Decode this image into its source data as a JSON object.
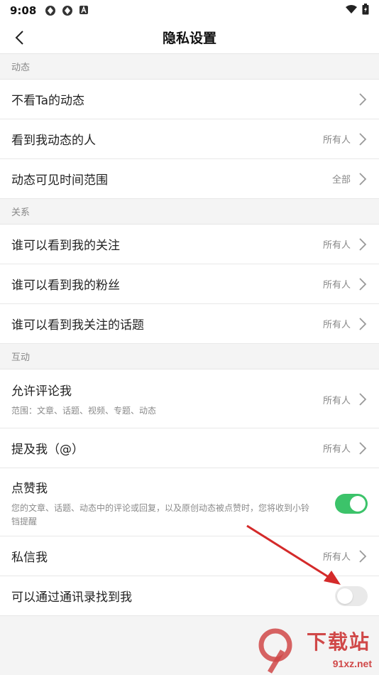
{
  "status_bar": {
    "time": "9:08"
  },
  "nav": {
    "title": "隐私设置"
  },
  "sections": {
    "dynamic": {
      "header": "动态",
      "rows": [
        {
          "label": "不看Ta的动态",
          "value": ""
        },
        {
          "label": "看到我动态的人",
          "value": "所有人"
        },
        {
          "label": "动态可见时间范围",
          "value": "全部"
        }
      ]
    },
    "relation": {
      "header": "关系",
      "rows": [
        {
          "label": "谁可以看到我的关注",
          "value": "所有人"
        },
        {
          "label": "谁可以看到我的粉丝",
          "value": "所有人"
        },
        {
          "label": "谁可以看到我关注的话题",
          "value": "所有人"
        }
      ]
    },
    "interaction": {
      "header": "互动",
      "comment": {
        "label": "允许评论我",
        "sub": "范围：文章、话题、视频、专题、动态",
        "value": "所有人"
      },
      "mention": {
        "label": "提及我（@）",
        "value": "所有人"
      },
      "like": {
        "label": "点赞我",
        "sub": "您的文章、话题、动态中的评论或回复，以及原创动态被点赞时，您将收到小铃铛提醒",
        "enabled": true
      },
      "message": {
        "label": "私信我",
        "value": "所有人"
      },
      "contacts": {
        "label": "可以通过通讯录找到我",
        "enabled": false
      }
    }
  },
  "colors": {
    "toggle_on": "#3cc36a",
    "toggle_off": "#e9e9e9",
    "annotation_arrow": "#d42a2a"
  },
  "watermark": {
    "brand": "下载站",
    "site": "91xz.net"
  }
}
